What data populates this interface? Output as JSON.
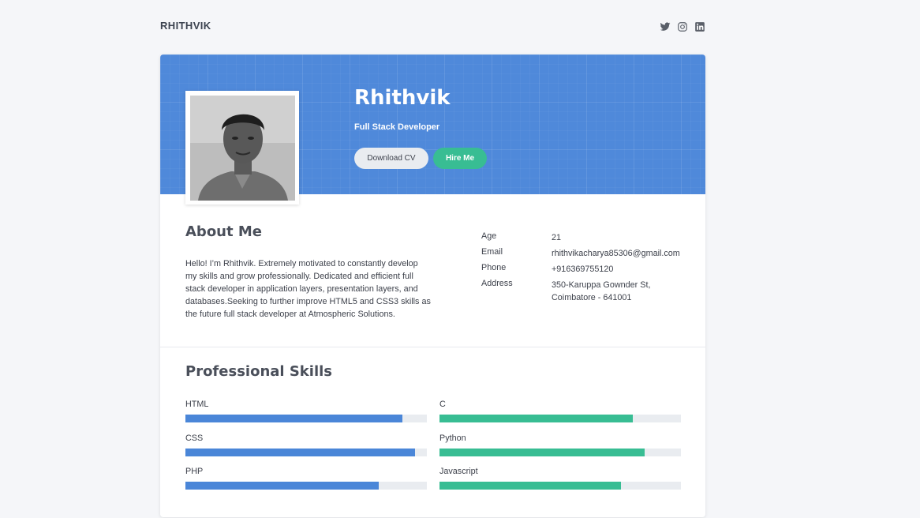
{
  "header": {
    "brand": "RHITHVIK",
    "social": [
      {
        "icon": "twitter-icon"
      },
      {
        "icon": "instagram-icon"
      },
      {
        "icon": "linkedin-icon"
      }
    ]
  },
  "hero": {
    "name": "Rhithvik",
    "role": "Full Stack Developer",
    "download_cv": "Download CV",
    "hire_me": "Hire Me"
  },
  "about": {
    "title": "About Me",
    "lines": [
      "Hello! I’m Rhithvik. Extremely motivated to constantly develop",
      "my skills and grow professionally. Dedicated and efficient full",
      "stack developer in application layers, presentation layers, and",
      "databases.Seeking to further improve HTML5 and CSS3 skills as",
      "the future full stack developer at Atmospheric Solutions."
    ],
    "info": [
      {
        "key": "Age",
        "value": "21"
      },
      {
        "key": "Email",
        "value": "rhithvikacharya85306@gmail.com"
      },
      {
        "key": "Phone",
        "value": "+916369755120"
      },
      {
        "key": "Address",
        "value": "350-Karuppa Gownder St,",
        "value2": "Coimbatore - 641001"
      }
    ]
  },
  "skills": {
    "title": "Professional Skills",
    "left": [
      {
        "name": "HTML",
        "level": 0.9
      },
      {
        "name": "CSS",
        "level": 0.95
      },
      {
        "name": "PHP",
        "level": 0.8
      }
    ],
    "right": [
      {
        "name": "C",
        "level": 0.8
      },
      {
        "name": "Python",
        "level": 0.85
      },
      {
        "name": "Javascript",
        "level": 0.75
      }
    ],
    "colors": {
      "left": "#4a86d8",
      "right": "#38bd93"
    }
  }
}
